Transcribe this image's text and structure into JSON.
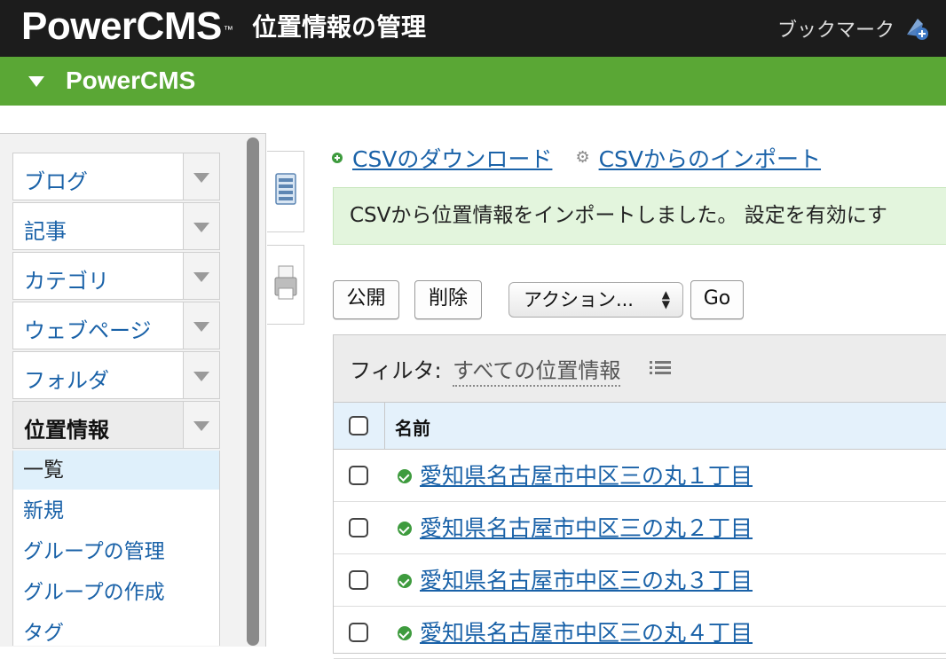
{
  "header": {
    "brand": "PowerCMS",
    "brand_tm": "™",
    "title": "位置情報の管理",
    "bookmark_label": "ブックマーク"
  },
  "site_bar": {
    "label": "PowerCMS"
  },
  "sidebar": {
    "menus": [
      {
        "label": "ブログ"
      },
      {
        "label": "記事"
      },
      {
        "label": "カテゴリ"
      },
      {
        "label": "ウェブページ"
      },
      {
        "label": "フォルダ"
      },
      {
        "label": "位置情報",
        "active": true
      }
    ],
    "submenu": [
      {
        "label": "一覧",
        "current": true
      },
      {
        "label": "新規"
      },
      {
        "label": "グループの管理"
      },
      {
        "label": "グループの作成"
      },
      {
        "label": "タグ"
      }
    ]
  },
  "main": {
    "csv_download": "CSVのダウンロード",
    "csv_import": "CSVからのインポート",
    "message": "CSVから位置情報をインポートしました。 設定を有効にす",
    "buttons": {
      "publish": "公開",
      "delete": "削除",
      "go": "Go"
    },
    "action_select": "アクション...",
    "filter_label": "フィルタ:",
    "filter_value": "すべての位置情報",
    "column_name": "名前",
    "rows": [
      {
        "name": "愛知県名古屋市中区三の丸１丁目"
      },
      {
        "name": "愛知県名古屋市中区三の丸２丁目"
      },
      {
        "name": "愛知県名古屋市中区三の丸３丁目"
      },
      {
        "name": "愛知県名古屋市中区三の丸４丁目"
      }
    ]
  },
  "colors": {
    "header_bg": "#1c1c1c",
    "site_bar": "#5aa735",
    "link": "#1a62a8",
    "success_bg": "#e3f5dd",
    "table_header": "#e4f1fb"
  }
}
